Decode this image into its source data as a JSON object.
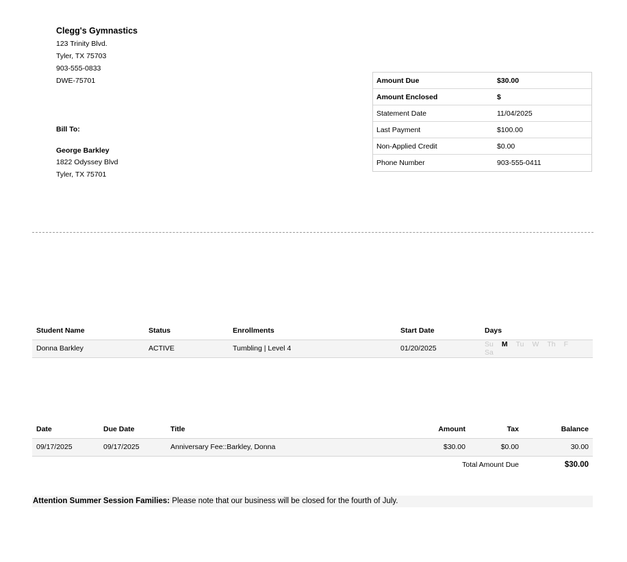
{
  "company": {
    "name": "Clegg's Gymnastics",
    "address1": "123 Trinity Blvd.",
    "address2": "Tyler, TX 75703",
    "phone": "903-555-0833",
    "code": "DWE-75701"
  },
  "bill_to": {
    "label": "Bill To:",
    "name": "George Barkley",
    "address1": "1822 Odyssey Blvd",
    "address2": "Tyler, TX 75701"
  },
  "summary": [
    {
      "label": "Amount Due",
      "value": "$30.00",
      "bold": true
    },
    {
      "label": "Amount Enclosed",
      "value": "$",
      "bold": true
    },
    {
      "label": "Statement Date",
      "value": "11/04/2025",
      "bold": false
    },
    {
      "label": "Last Payment",
      "value": "$100.00",
      "bold": false
    },
    {
      "label": "Non-Applied Credit",
      "value": "$0.00",
      "bold": false
    },
    {
      "label": "Phone Number",
      "value": "903-555-0411",
      "bold": false
    }
  ],
  "students": {
    "headers": [
      "Student Name",
      "Status",
      "Enrollments",
      "Start Date",
      "Days"
    ],
    "rows": [
      {
        "name": "Donna Barkley",
        "status": "ACTIVE",
        "enrollment": "Tumbling | Level 4",
        "start": "01/20/2025",
        "days": [
          {
            "label": "Su",
            "active": false
          },
          {
            "label": "M",
            "active": true
          },
          {
            "label": "Tu",
            "active": false
          },
          {
            "label": "W",
            "active": false
          },
          {
            "label": "Th",
            "active": false
          },
          {
            "label": "F",
            "active": false
          },
          {
            "label": "Sa",
            "active": false
          }
        ]
      }
    ]
  },
  "ledger": {
    "headers": [
      "Date",
      "Due Date",
      "Title",
      "Amount",
      "Tax",
      "Balance"
    ],
    "rows": [
      {
        "date": "09/17/2025",
        "due": "09/17/2025",
        "title": "Anniversary Fee::Barkley, Donna",
        "amount": "$30.00",
        "tax": "$0.00",
        "balance": "30.00"
      }
    ],
    "total_label": "Total Amount Due",
    "total_value": "$30.00"
  },
  "notice": {
    "heading": "Attention Summer Session Families:",
    "text": " Please note that our business will be closed for the fourth of July."
  }
}
